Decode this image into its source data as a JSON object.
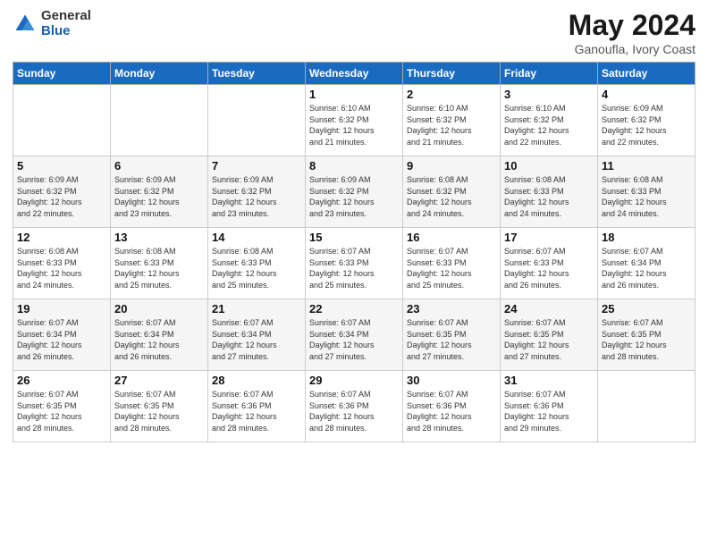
{
  "logo": {
    "general": "General",
    "blue": "Blue"
  },
  "header": {
    "month_year": "May 2024",
    "location": "Ganoufla, Ivory Coast"
  },
  "days_of_week": [
    "Sunday",
    "Monday",
    "Tuesday",
    "Wednesday",
    "Thursday",
    "Friday",
    "Saturday"
  ],
  "weeks": [
    [
      {
        "day": "",
        "info": ""
      },
      {
        "day": "",
        "info": ""
      },
      {
        "day": "",
        "info": ""
      },
      {
        "day": "1",
        "info": "Sunrise: 6:10 AM\nSunset: 6:32 PM\nDaylight: 12 hours\nand 21 minutes."
      },
      {
        "day": "2",
        "info": "Sunrise: 6:10 AM\nSunset: 6:32 PM\nDaylight: 12 hours\nand 21 minutes."
      },
      {
        "day": "3",
        "info": "Sunrise: 6:10 AM\nSunset: 6:32 PM\nDaylight: 12 hours\nand 22 minutes."
      },
      {
        "day": "4",
        "info": "Sunrise: 6:09 AM\nSunset: 6:32 PM\nDaylight: 12 hours\nand 22 minutes."
      }
    ],
    [
      {
        "day": "5",
        "info": "Sunrise: 6:09 AM\nSunset: 6:32 PM\nDaylight: 12 hours\nand 22 minutes."
      },
      {
        "day": "6",
        "info": "Sunrise: 6:09 AM\nSunset: 6:32 PM\nDaylight: 12 hours\nand 23 minutes."
      },
      {
        "day": "7",
        "info": "Sunrise: 6:09 AM\nSunset: 6:32 PM\nDaylight: 12 hours\nand 23 minutes."
      },
      {
        "day": "8",
        "info": "Sunrise: 6:09 AM\nSunset: 6:32 PM\nDaylight: 12 hours\nand 23 minutes."
      },
      {
        "day": "9",
        "info": "Sunrise: 6:08 AM\nSunset: 6:32 PM\nDaylight: 12 hours\nand 24 minutes."
      },
      {
        "day": "10",
        "info": "Sunrise: 6:08 AM\nSunset: 6:33 PM\nDaylight: 12 hours\nand 24 minutes."
      },
      {
        "day": "11",
        "info": "Sunrise: 6:08 AM\nSunset: 6:33 PM\nDaylight: 12 hours\nand 24 minutes."
      }
    ],
    [
      {
        "day": "12",
        "info": "Sunrise: 6:08 AM\nSunset: 6:33 PM\nDaylight: 12 hours\nand 24 minutes."
      },
      {
        "day": "13",
        "info": "Sunrise: 6:08 AM\nSunset: 6:33 PM\nDaylight: 12 hours\nand 25 minutes."
      },
      {
        "day": "14",
        "info": "Sunrise: 6:08 AM\nSunset: 6:33 PM\nDaylight: 12 hours\nand 25 minutes."
      },
      {
        "day": "15",
        "info": "Sunrise: 6:07 AM\nSunset: 6:33 PM\nDaylight: 12 hours\nand 25 minutes."
      },
      {
        "day": "16",
        "info": "Sunrise: 6:07 AM\nSunset: 6:33 PM\nDaylight: 12 hours\nand 25 minutes."
      },
      {
        "day": "17",
        "info": "Sunrise: 6:07 AM\nSunset: 6:33 PM\nDaylight: 12 hours\nand 26 minutes."
      },
      {
        "day": "18",
        "info": "Sunrise: 6:07 AM\nSunset: 6:34 PM\nDaylight: 12 hours\nand 26 minutes."
      }
    ],
    [
      {
        "day": "19",
        "info": "Sunrise: 6:07 AM\nSunset: 6:34 PM\nDaylight: 12 hours\nand 26 minutes."
      },
      {
        "day": "20",
        "info": "Sunrise: 6:07 AM\nSunset: 6:34 PM\nDaylight: 12 hours\nand 26 minutes."
      },
      {
        "day": "21",
        "info": "Sunrise: 6:07 AM\nSunset: 6:34 PM\nDaylight: 12 hours\nand 27 minutes."
      },
      {
        "day": "22",
        "info": "Sunrise: 6:07 AM\nSunset: 6:34 PM\nDaylight: 12 hours\nand 27 minutes."
      },
      {
        "day": "23",
        "info": "Sunrise: 6:07 AM\nSunset: 6:35 PM\nDaylight: 12 hours\nand 27 minutes."
      },
      {
        "day": "24",
        "info": "Sunrise: 6:07 AM\nSunset: 6:35 PM\nDaylight: 12 hours\nand 27 minutes."
      },
      {
        "day": "25",
        "info": "Sunrise: 6:07 AM\nSunset: 6:35 PM\nDaylight: 12 hours\nand 28 minutes."
      }
    ],
    [
      {
        "day": "26",
        "info": "Sunrise: 6:07 AM\nSunset: 6:35 PM\nDaylight: 12 hours\nand 28 minutes."
      },
      {
        "day": "27",
        "info": "Sunrise: 6:07 AM\nSunset: 6:35 PM\nDaylight: 12 hours\nand 28 minutes."
      },
      {
        "day": "28",
        "info": "Sunrise: 6:07 AM\nSunset: 6:36 PM\nDaylight: 12 hours\nand 28 minutes."
      },
      {
        "day": "29",
        "info": "Sunrise: 6:07 AM\nSunset: 6:36 PM\nDaylight: 12 hours\nand 28 minutes."
      },
      {
        "day": "30",
        "info": "Sunrise: 6:07 AM\nSunset: 6:36 PM\nDaylight: 12 hours\nand 28 minutes."
      },
      {
        "day": "31",
        "info": "Sunrise: 6:07 AM\nSunset: 6:36 PM\nDaylight: 12 hours\nand 29 minutes."
      },
      {
        "day": "",
        "info": ""
      }
    ]
  ]
}
